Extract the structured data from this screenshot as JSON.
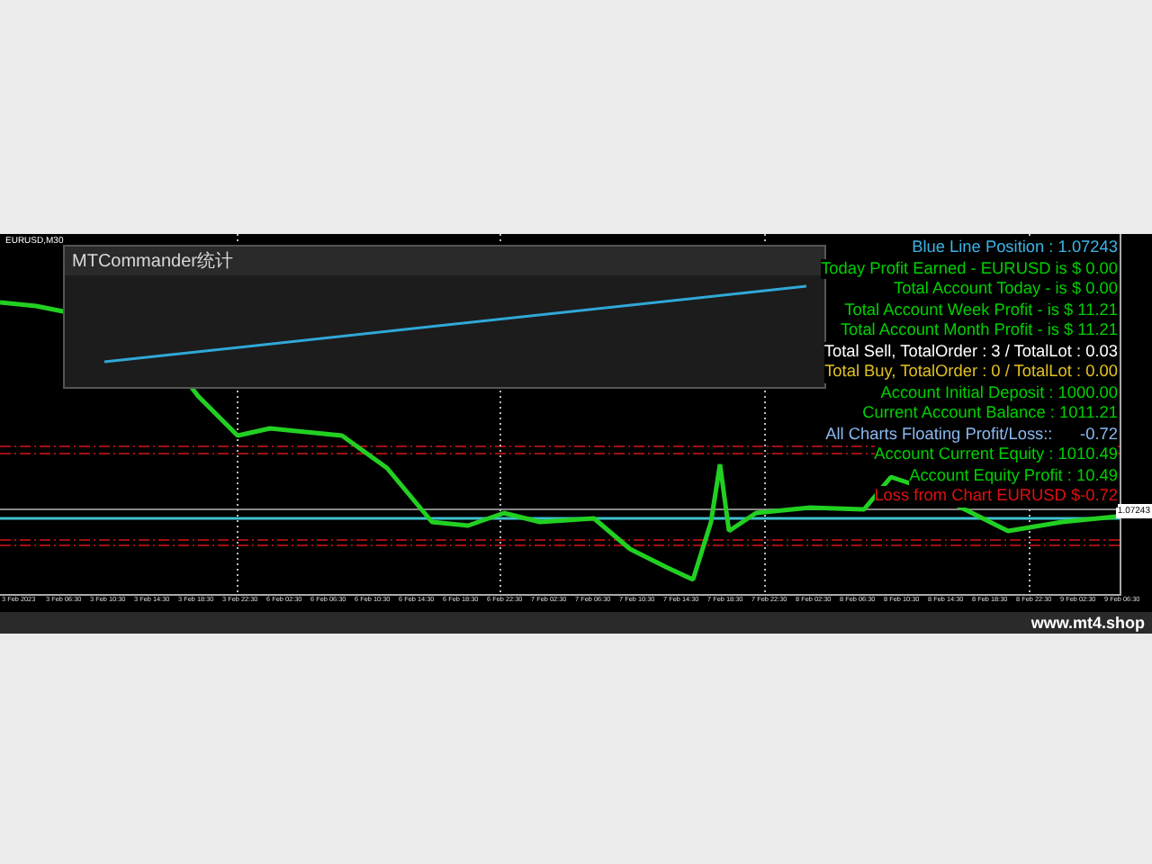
{
  "chart": {
    "symbol": "EURUSD,M30",
    "price_tag": "1.07243"
  },
  "stats_window": {
    "title": "MTCommander统计"
  },
  "info_lines": [
    {
      "text": "Blue Line Position : 1.07243",
      "color": "#3cb4e6"
    },
    {
      "text": "Today Profit Earned - EURUSD is $ 0.00",
      "color": "#00d000"
    },
    {
      "text": "Total Account Today - is $ 0.00",
      "color": "#00d000"
    },
    {
      "text": "Total Account Week Profit - is $ 11.21",
      "color": "#00d000"
    },
    {
      "text": "Total Account Month Profit - is $ 11.21",
      "color": "#00d000"
    },
    {
      "text": "Total Sell, TotalOrder : 3 / TotalLot : 0.03",
      "color": "#ffffff"
    },
    {
      "text": "Total Buy, TotalOrder : 0 / TotalLot : 0.00",
      "color": "#e0c020"
    },
    {
      "text": "Account Initial Deposit : 1000.00",
      "color": "#00d000"
    },
    {
      "text": "Current Account Balance : 1011.21",
      "color": "#00d000"
    },
    {
      "text": "All Charts Floating Profit/Loss::      -0.72",
      "color": "#8ab8f0"
    },
    {
      "text": "Account Current Equity : 1010.49",
      "color": "#00d000"
    },
    {
      "text": "Account Equity Profit : 10.49",
      "color": "#00d000"
    },
    {
      "text": "Loss from Chart EURUSD $-0.72",
      "color": "#e01010"
    }
  ],
  "time_axis": [
    "3 Feb 2023",
    "3 Feb 06:30",
    "3 Feb 10:30",
    "3 Feb 14:30",
    "3 Feb 18:30",
    "3 Feb 22:30",
    "6 Feb 02:30",
    "6 Feb 06:30",
    "6 Feb 10:30",
    "6 Feb 14:30",
    "6 Feb 18:30",
    "6 Feb 22:30",
    "7 Feb 02:30",
    "7 Feb 06:30",
    "7 Feb 10:30",
    "7 Feb 14:30",
    "7 Feb 18:30",
    "7 Feb 22:30",
    "8 Feb 02:30",
    "8 Feb 06:30",
    "8 Feb 10:30",
    "8 Feb 14:30",
    "8 Feb 18:30",
    "8 Feb 22:30",
    "9 Feb 02:30",
    "9 Feb 06:30"
  ],
  "watermark_site": "www.mt4.shop"
}
